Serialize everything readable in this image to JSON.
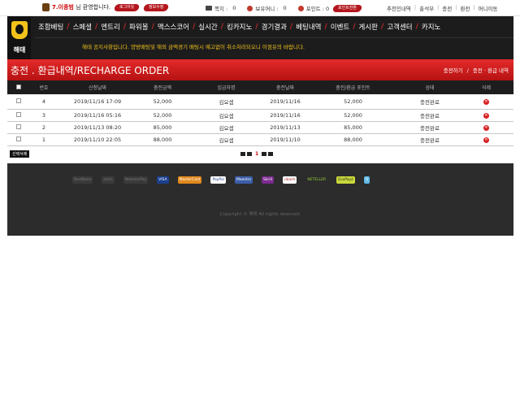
{
  "topbar": {
    "welcome_name": "7.이종범",
    "welcome_text": "님 환영합니다.",
    "logout_label": "로그아웃",
    "edit_info_label": "정보수정",
    "mail_label": "쪽지 :",
    "mail_count": "0",
    "holding_label": "보유머니 :",
    "holding_value": "0",
    "point_label": "포인트 : 0",
    "point_convert_label": "포인트전환",
    "links": [
      "추천인내역",
      "출석부",
      "충전",
      "환전",
      "머니이동"
    ]
  },
  "header": {
    "logo_text": "해태",
    "nav": [
      "조합베팅",
      "스페셜",
      "엔트리",
      "파워볼",
      "맥스스코어",
      "실시간",
      "킹카지노",
      "경기결과",
      "베팅내역",
      "이벤트",
      "게시판",
      "고객센터",
      "카지노"
    ],
    "notice": "해태 공지사항입니다. 양방배팅및 해외 금액경기 배팅시 예고없이 취소처리되오니 이점유의 바랍니다."
  },
  "title": {
    "text": "충전 . 환급내역/RECHARGE ORDER",
    "crumb1": "충전하기",
    "crumb2": "충전 · 환급 내역"
  },
  "table": {
    "headers": [
      "번호",
      "신청날짜",
      "충전금액",
      "입금자명",
      "충전날짜",
      "충전/환급 포인트",
      "상태",
      "삭제"
    ],
    "rows": [
      {
        "no": "4",
        "req_date": "2019/11/16 17:09",
        "amount": "52,000",
        "depositor": "김요셉",
        "charge_date": "2019/11/16",
        "points": "52,000",
        "status": "충전완료"
      },
      {
        "no": "3",
        "req_date": "2019/11/16 05:16",
        "amount": "52,000",
        "depositor": "김요셉",
        "charge_date": "2019/11/16",
        "points": "52,000",
        "status": "충전완료"
      },
      {
        "no": "2",
        "req_date": "2019/11/13 08:20",
        "amount": "85,000",
        "depositor": "김요셉",
        "charge_date": "2019/11/13",
        "points": "85,000",
        "status": "충전완료"
      },
      {
        "no": "1",
        "req_date": "2019/11/10 22:05",
        "amount": "88,000",
        "depositor": "김요셉",
        "charge_date": "2019/11/10",
        "points": "88,000",
        "status": "충전완료"
      }
    ]
  },
  "actions": {
    "delete_selected": "선택삭제",
    "current_page": "1"
  },
  "footer": {
    "logos": [
      "BestBank",
      "astro",
      "NeteasePay",
      "VISA",
      "MasterCard",
      "PayPal",
      "Maestro",
      "Skrill",
      "ukash",
      "NETELLER",
      "EcoPayz",
      "Q"
    ],
    "copyright": "Copyright © 해태 All rights reserved."
  },
  "colors": {
    "accent_red": "#d62020",
    "notice_yellow": "#f1c21b",
    "header_bg": "#1c1c1c",
    "footer_bg": "#2c2c2c"
  }
}
